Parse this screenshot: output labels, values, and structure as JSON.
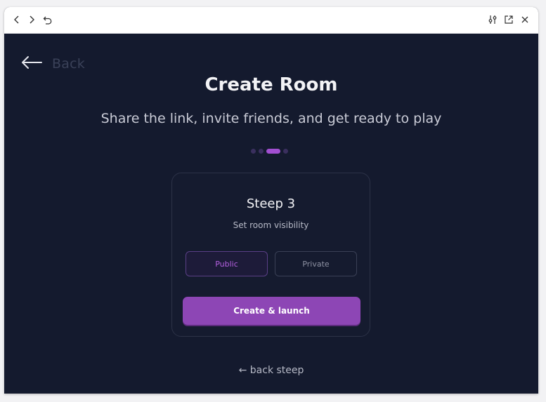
{
  "titlebar": {
    "icons": [
      "chevron-left-icon",
      "chevron-right-icon",
      "undo-icon",
      "sliders-icon",
      "external-link-icon",
      "close-icon"
    ]
  },
  "nav": {
    "back_label": "Back"
  },
  "header": {
    "title": "Create Room",
    "subtitle": "Share the link, invite friends, and get ready to play"
  },
  "stepper": {
    "total_steps": 4,
    "current_step": 3
  },
  "card": {
    "title": "Steep 3",
    "subtitle": "Set room visibility",
    "options": [
      "Public",
      "Private"
    ],
    "selected_option": "Public",
    "launch_label": "Create & launch"
  },
  "footer": {
    "back_steep_label": "← back steep"
  },
  "colors": {
    "background": "#141a2e",
    "accent": "#8d46b5",
    "accent_text": "#b45fe0"
  }
}
